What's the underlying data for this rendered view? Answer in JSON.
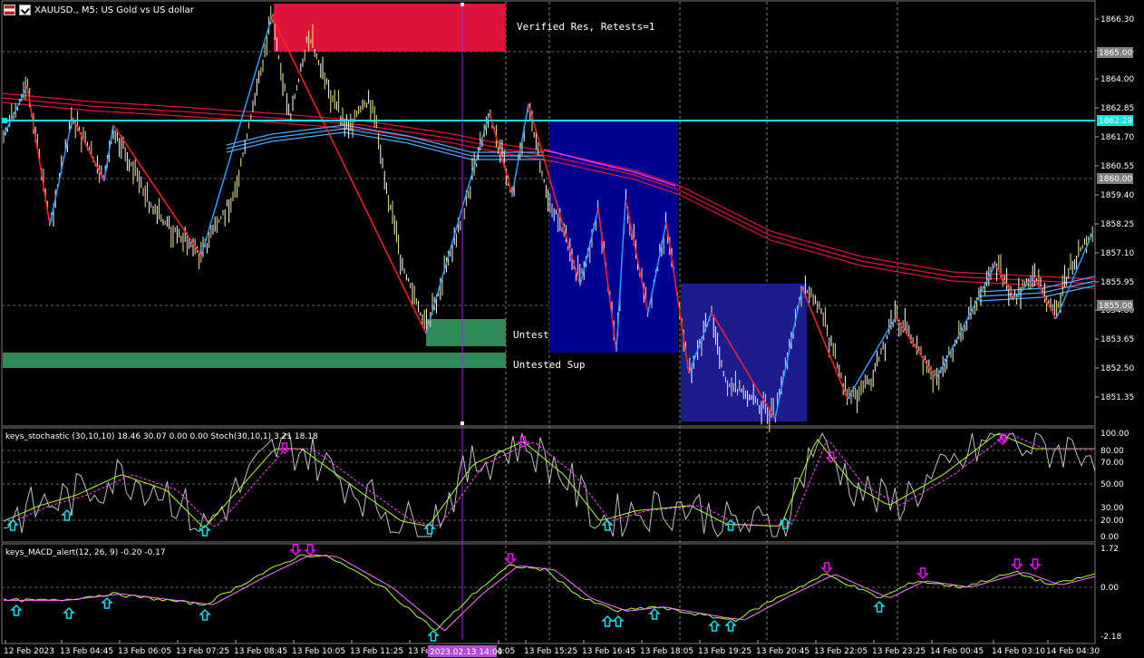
{
  "window": {
    "symbol_title": "XAUUSD., M5:  US Gold vs US dollar"
  },
  "price_axis": {
    "ticks": [
      "1866.30",
      "1865.15",
      "1864.00",
      "1862.85",
      "1861.70",
      "1860.55",
      "1859.40",
      "1858.25",
      "1857.10",
      "1855.95",
      "1854.80",
      "1853.65",
      "1852.50",
      "1851.35"
    ],
    "tags": [
      {
        "text": "1865.00",
        "color": "#808080"
      },
      {
        "text": "1862.29",
        "color": "#00e5ee"
      },
      {
        "text": "1860.00",
        "color": "#808080"
      },
      {
        "text": "1855.00",
        "color": "#808080"
      }
    ]
  },
  "zones": [
    {
      "label": "Verified Res, Retests=1",
      "type": "resistance",
      "color": "#dc143c"
    },
    {
      "label": "Untested Sup",
      "type": "support",
      "color": "#2e8b57"
    },
    {
      "label": "Untested Sup",
      "type": "support",
      "color": "#2e8b57"
    }
  ],
  "time_axis": {
    "ticks": [
      "12 Feb 2023",
      "13 Feb 04:45",
      "13 Feb 06:05",
      "13 Feb 07:25",
      "13 Feb 08:45",
      "13 Feb 10:05",
      "13 Feb 11:25",
      "13 Fe",
      "4:05",
      "13 Feb 15:25",
      "13 Feb 16:45",
      "13 Feb 18:05",
      "13 Feb 19:25",
      "13 Feb 20:45",
      "13 Feb 22:05",
      "13 Feb 23:25",
      "14 Feb 00:45",
      "14 Feb 03:10",
      "14 Feb 04:30"
    ],
    "cursor_label": "2023.02.13 14:00"
  },
  "stochastic": {
    "title": "keys_stochastic (30,10,10) 18.46 30.07 0.00 0.00 Stoch(30,10,1) 3.21 18.18",
    "ticks": [
      "100.00",
      "80.00",
      "70.00",
      "50.00",
      "30.00",
      "20.00",
      "0.00"
    ]
  },
  "macd": {
    "title": "keys_MACD_alert(12, 26, 9) -0.20 -0.17",
    "ticks": [
      "1.72",
      "0.00",
      "-2.18"
    ]
  },
  "colors": {
    "ema_red": "#dc143c",
    "ema_blue": "#1e90ff",
    "zigzag_up": "#1e90ff",
    "zigzag_down": "#ff2020",
    "hline": "#00e5ee",
    "zone_blue": "#000080",
    "zone_blue2": "#1c1c8c",
    "arrow_up": "#00e5ee",
    "arrow_down": "#ff00ff"
  }
}
